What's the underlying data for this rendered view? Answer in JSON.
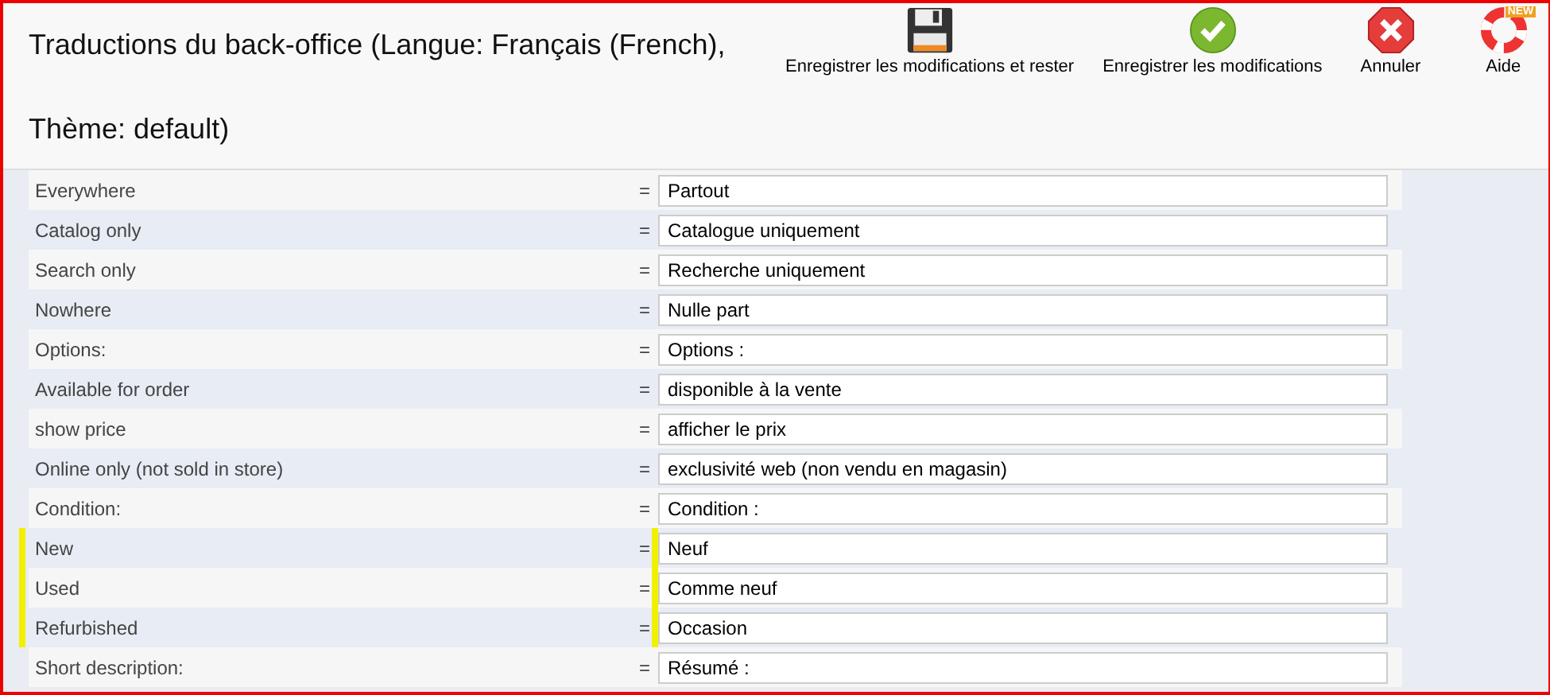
{
  "header": {
    "title": "Traductions du back-office (Langue: Français (French), Thème: default)",
    "buttons": [
      {
        "kind": "save-stay",
        "label": "Enregistrer les modifications et rester"
      },
      {
        "kind": "save",
        "label": "Enregistrer les modifications"
      },
      {
        "kind": "cancel",
        "label": "Annuler"
      },
      {
        "kind": "help",
        "label": "Aide",
        "badge": "NEW"
      }
    ]
  },
  "rows": [
    {
      "label": "Everywhere",
      "separator": "=",
      "value": "Partout",
      "highlighted": false
    },
    {
      "label": "Catalog only",
      "separator": "=",
      "value": "Catalogue uniquement",
      "highlighted": false
    },
    {
      "label": "Search only",
      "separator": "=",
      "value": "Recherche uniquement",
      "highlighted": false
    },
    {
      "label": "Nowhere",
      "separator": "=",
      "value": "Nulle part",
      "highlighted": false
    },
    {
      "label": "Options:",
      "separator": "=",
      "value": "Options :",
      "highlighted": false
    },
    {
      "label": "Available for order",
      "separator": "=",
      "value": "disponible à la vente",
      "highlighted": false
    },
    {
      "label": "show price",
      "separator": "=",
      "value": "afficher le prix",
      "highlighted": false
    },
    {
      "label": "Online only (not sold in store)",
      "separator": "=",
      "value": "exclusivité web (non vendu en magasin)",
      "highlighted": false
    },
    {
      "label": "Condition:",
      "separator": "=",
      "value": "Condition :",
      "highlighted": false
    },
    {
      "label": "New",
      "separator": "=",
      "value": "Neuf",
      "highlighted": true
    },
    {
      "label": "Used",
      "separator": "=",
      "value": "Comme neuf",
      "highlighted": true
    },
    {
      "label": "Refurbished",
      "separator": "=",
      "value": "Occasion",
      "highlighted": true
    },
    {
      "label": "Short description:",
      "separator": "=",
      "value": "Résumé :",
      "highlighted": false
    }
  ]
}
